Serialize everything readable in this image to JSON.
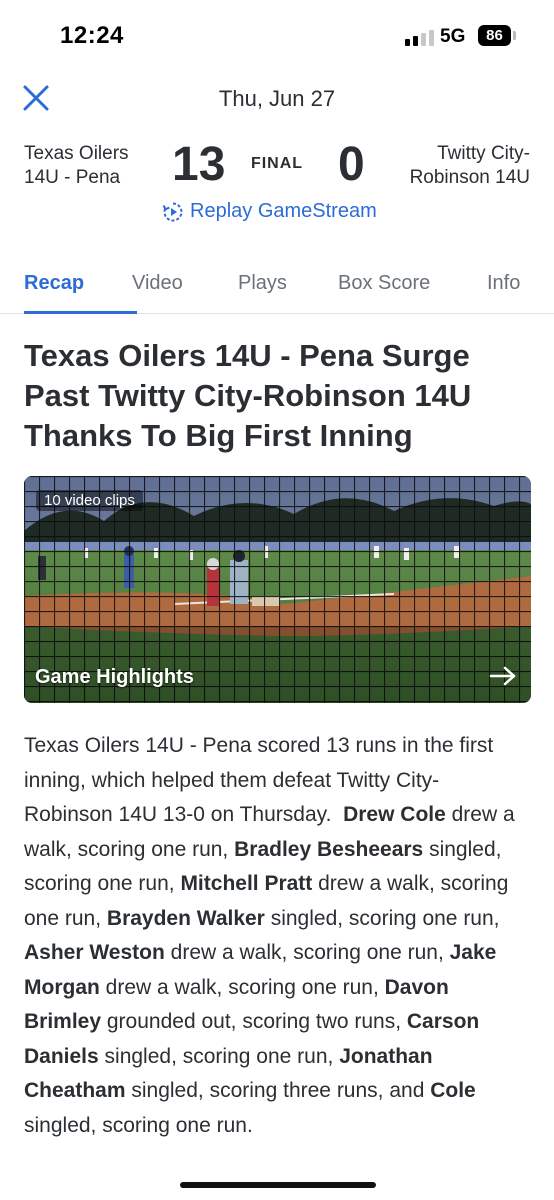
{
  "status_bar": {
    "time": "12:24",
    "network": "5G",
    "battery": "86"
  },
  "header": {
    "date": "Thu, Jun 27",
    "close_icon": "close-x-icon"
  },
  "scoreboard": {
    "home_team_line1": "Texas Oilers",
    "home_team_line2": "14U - Pena",
    "home_score": "13",
    "status": "FINAL",
    "away_score": "0",
    "away_team_line1": "Twitty City-",
    "away_team_line2": "Robinson 14U",
    "replay_label": "Replay GameStream"
  },
  "tabs": [
    {
      "label": "Recap",
      "active": true
    },
    {
      "label": "Video",
      "active": false
    },
    {
      "label": "Plays",
      "active": false
    },
    {
      "label": "Box Score",
      "active": false
    },
    {
      "label": "Info",
      "active": false
    }
  ],
  "article": {
    "headline": "Texas Oilers 14U - Pena Surge Past Twitty City-Robinson 14U Thanks To Big First Inning",
    "video": {
      "badge": "10 video clips",
      "title": "Game Highlights"
    },
    "recap_intro": "Texas Oilers 14U - Pena scored 13 runs in the first inning, which helped them defeat Twitty City-Robinson 14U 13-0 on Thursday.",
    "plays": [
      {
        "player": "Drew Cole",
        "text": " drew a walk, scoring one run, "
      },
      {
        "player": "Bradley Besheears",
        "text": " singled, scoring one run, "
      },
      {
        "player": "Mitchell Pratt",
        "text": " drew a walk, scoring one run, "
      },
      {
        "player": "Brayden Walker",
        "text": " singled, scoring one run, "
      },
      {
        "player": "Asher Weston",
        "text": " drew a walk, scoring one run, "
      },
      {
        "player": "Jake Morgan",
        "text": " drew a walk, scoring one run, "
      },
      {
        "player": "Davon Brimley",
        "text": " grounded out, scoring two runs, "
      },
      {
        "player": "Carson Daniels",
        "text": " singled, scoring one run, "
      },
      {
        "player": "Jonathan Cheatham",
        "text": " singled, scoring three runs, and "
      },
      {
        "player": "Cole",
        "text": " singled, scoring one run."
      }
    ]
  },
  "colors": {
    "accent": "#2d6bd6",
    "text": "#2b2f33",
    "muted": "#6b7178"
  }
}
